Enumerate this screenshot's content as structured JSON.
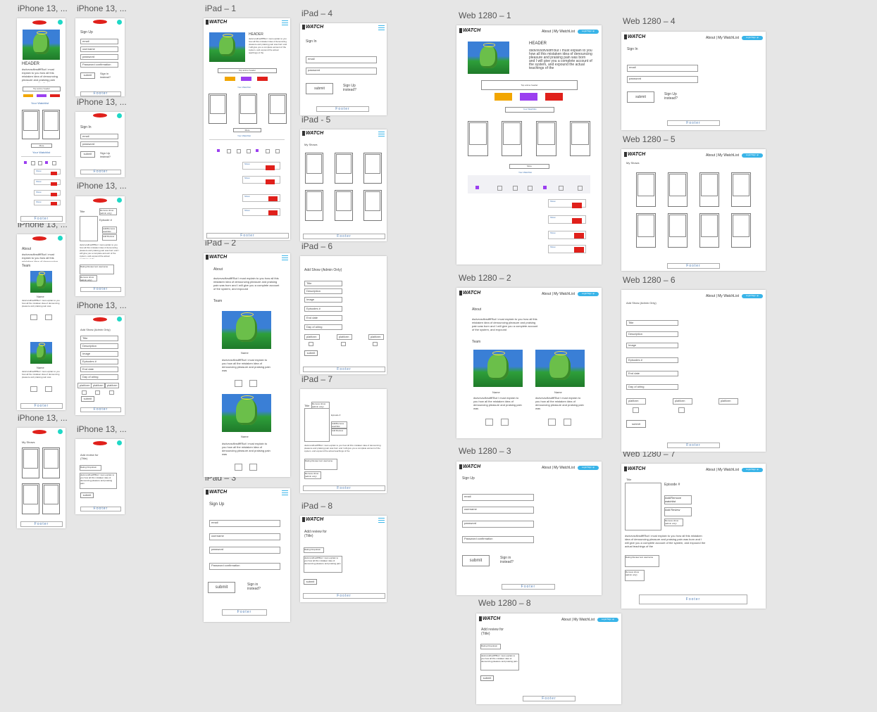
{
  "labels": {
    "ip1": "iPhone 13, ...",
    "ip2": "iPhone 13, ...",
    "ip3": "iPhone 13, ...",
    "ip4": "iPhone 13, ...",
    "ip5": "iPhone 13, ...",
    "ip6": "iPhone 13, ...",
    "ip7": "iPhone 13, ...",
    "ip8": "iPhone 13, ...",
    "ipad1": "iPad – 1",
    "ipad2": "iPad – 2",
    "ipad3": "iPad – 3",
    "ipad4": "iPad – 4",
    "ipad5": "iPad - 5",
    "ipad6": "iPad – 6",
    "ipad7": "iPad – 7",
    "ipad8": "iPad – 8",
    "web1": "Web 1280 – 1",
    "web2": "Web 1280 – 2",
    "web3": "Web 1280 – 3",
    "web4": "Web 1280 – 4",
    "web5": "Web 1280 – 5",
    "web6": "Web 1280 – 6",
    "web7": "Web 1280 – 7",
    "web8": "Web 1280 – 8"
  },
  "common": {
    "logo": "WATCH",
    "footer": "Footer",
    "nav_links": "About | My WatchList",
    "login_pill": "Login/Sign up",
    "submit": "submit",
    "signin_instead": "Sign in instead?",
    "signup_instead": "Sign Up instead?",
    "email": "email",
    "password": "password",
    "username": "username",
    "password_confirmation": "Password confirmation"
  },
  "home": {
    "header": "HEADER",
    "body": "dsdvxvsdfvsdfff'But I must explain to you how all this mistaken idea of denouncing pleasure and praising pain was born and I will give you a complete account of the system, and expound the actual teachings of the",
    "long_button": "Top anime header",
    "more": "More",
    "watchlist": "Your Watchlist",
    "show": "Show"
  },
  "signin": {
    "title": "Sign In"
  },
  "signup": {
    "title": "Sign Up"
  },
  "about": {
    "title": "About",
    "body": "dsdvxvsdfvsdfff'But I must explain to you how all this mistaken idea of denouncing pleasure and praising pain was born and I will give you a complete account of the system, and expound",
    "team": "Team",
    "name": "Name",
    "member_bio": "dsdvxvsdfvsdfff'But I must explain to you how all the mistaken idea of denouncing pleasure and praising pain was"
  },
  "myshows": {
    "title": "My Shows"
  },
  "addshow": {
    "title": "Add Show (Admin Only)",
    "fields": [
      "Title",
      "Description",
      "Image",
      "Episodes #",
      "End date",
      "Day of airing"
    ],
    "platform": "platform"
  },
  "detail": {
    "title": "Title",
    "episode": "Episode #",
    "add_remove": "Add/Remove watchlist",
    "add_review": "Add Review",
    "remove": "Remove show (admin only)",
    "body": "dsdvxvsdfvsdfff'But I must explain to you how all this mistaken idea of denouncing pleasure and praising pain was born and I will give you a complete account of the system, and expound the actual teachings of the",
    "rating": "Rating Review text username"
  },
  "review": {
    "title": "Add review for (Title)",
    "rating": "Rating Dropdown",
    "body": "dsdvxvsdfvsdfff'But I must explain to you how all this mistaken idea of denouncing pleasure and praising pain"
  },
  "colors": {
    "canvas": "#e6e6e6",
    "accent_cyan": "#39b4e8",
    "red": "#e0201b",
    "orange": "#f2a600",
    "purple": "#9b3ff0",
    "teal": "#1fd8c6"
  }
}
